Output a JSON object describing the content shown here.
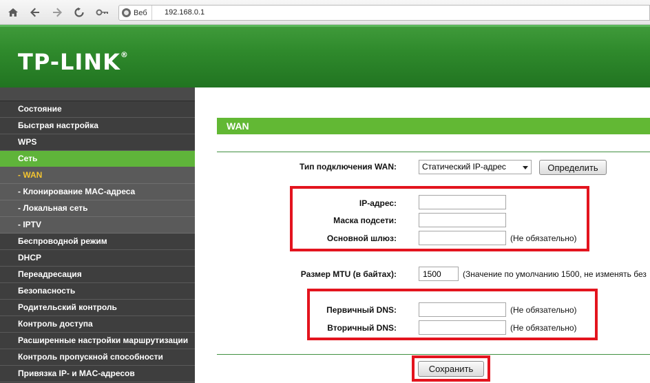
{
  "browser": {
    "address_tag": "Веб",
    "url": "192.168.0.1",
    "icons": [
      "home-icon",
      "back-icon",
      "forward-icon",
      "reload-icon",
      "key-icon"
    ]
  },
  "header": {
    "logo": "TP-LINK",
    "logo_mark": "®"
  },
  "sidebar": {
    "items": [
      {
        "label": "Состояние",
        "kind": "main"
      },
      {
        "label": "Быстрая настройка",
        "kind": "main"
      },
      {
        "label": "WPS",
        "kind": "main"
      },
      {
        "label": "Сеть",
        "kind": "active"
      },
      {
        "label": "- WAN",
        "kind": "sub-active"
      },
      {
        "label": "- Клонирование MAC-адреса",
        "kind": "sub"
      },
      {
        "label": "- Локальная сеть",
        "kind": "sub"
      },
      {
        "label": "- IPTV",
        "kind": "sub"
      },
      {
        "label": "Беспроводной режим",
        "kind": "main"
      },
      {
        "label": "DHCP",
        "kind": "main"
      },
      {
        "label": "Переадресация",
        "kind": "main"
      },
      {
        "label": "Безопасность",
        "kind": "main"
      },
      {
        "label": "Родительский контроль",
        "kind": "main"
      },
      {
        "label": "Контроль доступа",
        "kind": "main"
      },
      {
        "label": "Расширенные настройки маршрутизации",
        "kind": "main"
      },
      {
        "label": "Контроль пропускной способности",
        "kind": "main"
      },
      {
        "label": "Привязка IP- и MAC-адресов",
        "kind": "main"
      }
    ]
  },
  "main": {
    "section_title": "WAN",
    "connection_type_label": "Тип подключения WAN:",
    "connection_type_value": "Статический IP-адрес",
    "detect_button": "Определить",
    "ip_label": "IP-адрес:",
    "ip_value": "",
    "mask_label": "Маска подсети:",
    "mask_value": "",
    "gateway_label": "Основной шлюз:",
    "gateway_value": "",
    "gateway_note": "(Не обязательно)",
    "mtu_label": "Размер MTU (в байтах):",
    "mtu_value": "1500",
    "mtu_note": "(Значение по умолчанию 1500, не изменять без",
    "dns1_label": "Первичный DNS:",
    "dns1_value": "",
    "dns1_note": "(Не обязательно)",
    "dns2_label": "Вторичный DNS:",
    "dns2_value": "",
    "dns2_note": "(Не обязательно)",
    "save_button": "Сохранить"
  },
  "colors": {
    "header_green": "#2f8a2c",
    "section_green": "#62b834",
    "active_menu": "#5fb43a",
    "highlight_red": "#e3141e",
    "sidebar_dark": "#3e3e3e"
  }
}
